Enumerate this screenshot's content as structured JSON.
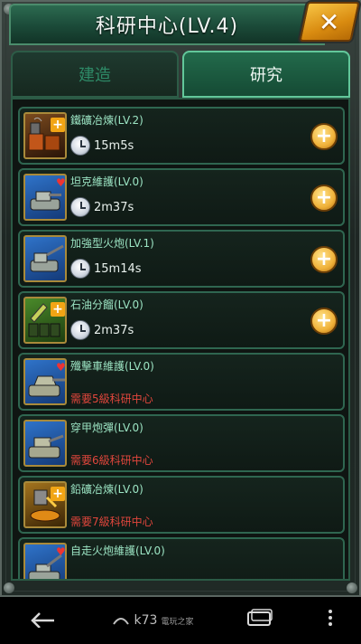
{
  "header": {
    "title": "科研中心(LV.4)",
    "close_label": "✕"
  },
  "tabs": [
    {
      "label": "建造",
      "active": false
    },
    {
      "label": "研究",
      "active": true
    }
  ],
  "research_items": [
    {
      "name": "鐵礦冶煉(LV.2)",
      "time": "15m5s",
      "available": true,
      "icon": "iron-smelting-icon"
    },
    {
      "name": "坦克維護(LV.0)",
      "time": "2m37s",
      "available": true,
      "icon": "tank-maintenance-icon"
    },
    {
      "name": "加強型火炮(LV.1)",
      "time": "15m14s",
      "available": true,
      "icon": "enhanced-artillery-icon"
    },
    {
      "name": "石油分餾(LV.0)",
      "time": "2m37s",
      "available": true,
      "icon": "oil-fractionation-icon"
    },
    {
      "name": "殲擊車維護(LV.0)",
      "requirement": "需要5級科研中心",
      "available": false,
      "icon": "tank-destroyer-icon"
    },
    {
      "name": "穿甲炮彈(LV.0)",
      "requirement": "需要6級科研中心",
      "available": false,
      "icon": "ap-shell-icon"
    },
    {
      "name": "鉛礦冶煉(LV.0)",
      "requirement": "需要7級科研中心",
      "available": false,
      "icon": "lead-smelting-icon"
    },
    {
      "name": "自走火炮維護(LV.0)",
      "available": false,
      "icon": "self-propelled-gun-icon"
    }
  ],
  "navbar": {
    "back_icon": "back-arrow-icon",
    "home_icon": "home-icon",
    "recents_icon": "recents-icon",
    "menu_icon": "menu-dots-icon",
    "watermark_text": "k73",
    "watermark_sub": "電玩之家"
  },
  "colors": {
    "accent_green": "#2f6650",
    "title_green": "#1b4a38",
    "requirement_red": "#e0463c",
    "plus_gold": "#f0b23a"
  }
}
